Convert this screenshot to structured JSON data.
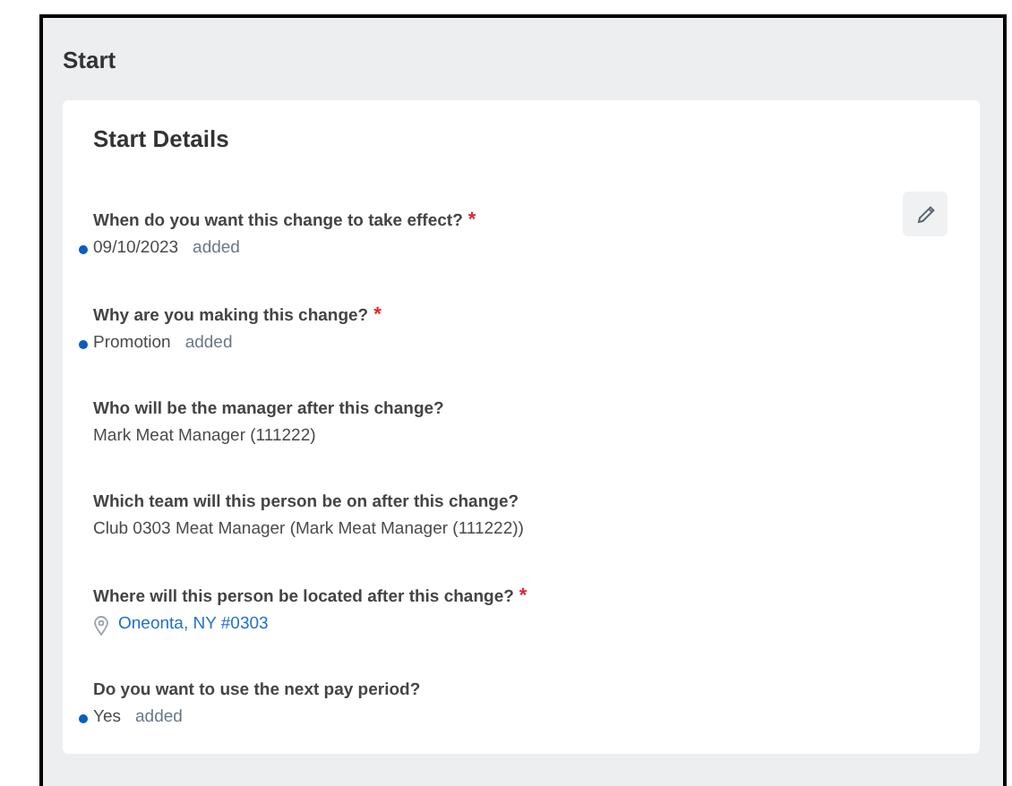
{
  "section": {
    "title": "Start"
  },
  "card": {
    "title": "Start Details",
    "fields": [
      {
        "kind": "text",
        "question": "When do you want this change to take effect?",
        "required_mark": "*",
        "value": "09/10/2023",
        "changed": true,
        "tag": "added"
      },
      {
        "kind": "text",
        "question": "Why are you making this change?",
        "required_mark": "*",
        "value": "Promotion",
        "changed": true,
        "tag": "added"
      },
      {
        "kind": "text",
        "question": "Who will be the manager after this change?",
        "value": "Mark Meat Manager (111222)",
        "changed": false
      },
      {
        "kind": "text",
        "question": "Which team will this person be on after this change?",
        "value": "Club 0303 Meat Manager (Mark Meat Manager (111222))",
        "changed": false
      },
      {
        "kind": "location",
        "question": "Where will this person be located after this change?",
        "required_mark": "*",
        "value": "Oneonta, NY #0303",
        "changed": false
      },
      {
        "kind": "text",
        "question": "Do you want to use the next pay period?",
        "value": "Yes",
        "changed": true,
        "tag": "added"
      }
    ]
  }
}
